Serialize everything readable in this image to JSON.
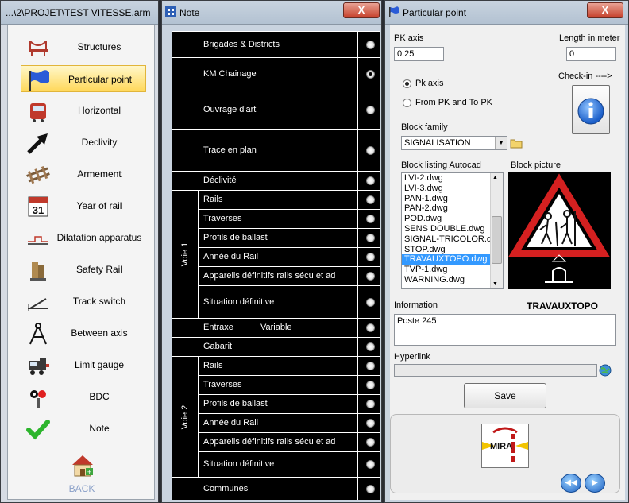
{
  "window_structures": {
    "title": "...\\2\\PROJET\\TEST VITESSE.arm",
    "items": [
      {
        "label": "Structures",
        "icon": "bridge-icon"
      },
      {
        "label": "Particular point",
        "icon": "flag-icon",
        "active": true
      },
      {
        "label": "Horizontal",
        "icon": "train-icon"
      },
      {
        "label": "Declivity",
        "icon": "arrow-up-icon"
      },
      {
        "label": "Armement",
        "icon": "rail-track-icon"
      },
      {
        "label": "Year of rail",
        "icon": "calendar-icon"
      },
      {
        "label": "Dilatation apparatus",
        "icon": "dilatation-icon"
      },
      {
        "label": "Safety Rail",
        "icon": "safety-rail-icon"
      },
      {
        "label": "Track switch",
        "icon": "track-switch-icon"
      },
      {
        "label": "Between axis",
        "icon": "compass-icon"
      },
      {
        "label": "Limit gauge",
        "icon": "locomotive-icon"
      },
      {
        "label": "BDC",
        "icon": "signal-icon"
      },
      {
        "label": "Note",
        "icon": "checkmark-icon"
      }
    ],
    "back_label": "BACK"
  },
  "window_note": {
    "title": "Note",
    "close": "X",
    "rows": [
      {
        "label": "Brigades & Districts",
        "checked": false
      },
      {
        "label": "KM Chainage",
        "checked": true
      },
      {
        "label": "Ouvrage d'art",
        "checked": false
      },
      {
        "label": "Trace en plan",
        "checked": false
      },
      {
        "label": "Déclivité",
        "checked": false
      },
      {
        "label": "Rails",
        "checked": false
      },
      {
        "label": "Traverses",
        "checked": false
      },
      {
        "label": "Profils de ballast",
        "checked": false
      },
      {
        "label": "Année du Rail",
        "checked": false
      },
      {
        "label": "Appareils définitifs rails sécu et ad",
        "checked": false
      },
      {
        "label": "Situation définitive",
        "checked": false
      },
      {
        "label": "Entraxe",
        "extra": "Variable",
        "checked": false
      },
      {
        "label": "Gabarit",
        "checked": false
      },
      {
        "label": "Rails",
        "checked": false
      },
      {
        "label": "Traverses",
        "checked": false
      },
      {
        "label": "Profils de ballast",
        "checked": false
      },
      {
        "label": "Année du Rail",
        "checked": false
      },
      {
        "label": "Appareils définitifs rails sécu et ad",
        "checked": false
      },
      {
        "label": "Situation définitive",
        "checked": false
      },
      {
        "label": "Communes",
        "checked": false
      }
    ],
    "voie1": "Voie 1",
    "voie2": "Voie 2"
  },
  "window_particular": {
    "title": "Particular point",
    "close": "X",
    "pk_axis_label": "PK axis",
    "pk_axis_value": "0.25",
    "length_label": "Length in meter",
    "length_value": "0",
    "radio_pk_axis": "Pk axis",
    "radio_from_pk": "From PK and To PK",
    "checkin_label": "Check-in ---->",
    "block_family_label": "Block family",
    "block_family_value": "SIGNALISATION",
    "block_listing_label": "Block listing Autocad",
    "block_picture_label": "Block picture",
    "block_list": [
      "LVI-2.dwg",
      "LVI-3.dwg",
      "PAN-1.dwg",
      "PAN-2.dwg",
      "POD.dwg",
      "SENS DOUBLE.dwg",
      "SIGNAL-TRICOLOR.dwg",
      "STOP.dwg",
      "TRAVAUXTOPO.dwg",
      "TVP-1.dwg",
      "WARNING.dwg"
    ],
    "block_selected": "TRAVAUXTOPO.dwg",
    "information_label": "Information",
    "block_name": "TRAVAUXTOPO",
    "information_value": "Poste 245",
    "hyperlink_label": "Hyperlink",
    "hyperlink_value": "",
    "save_label": "Save",
    "logo_text": "MIRA"
  }
}
